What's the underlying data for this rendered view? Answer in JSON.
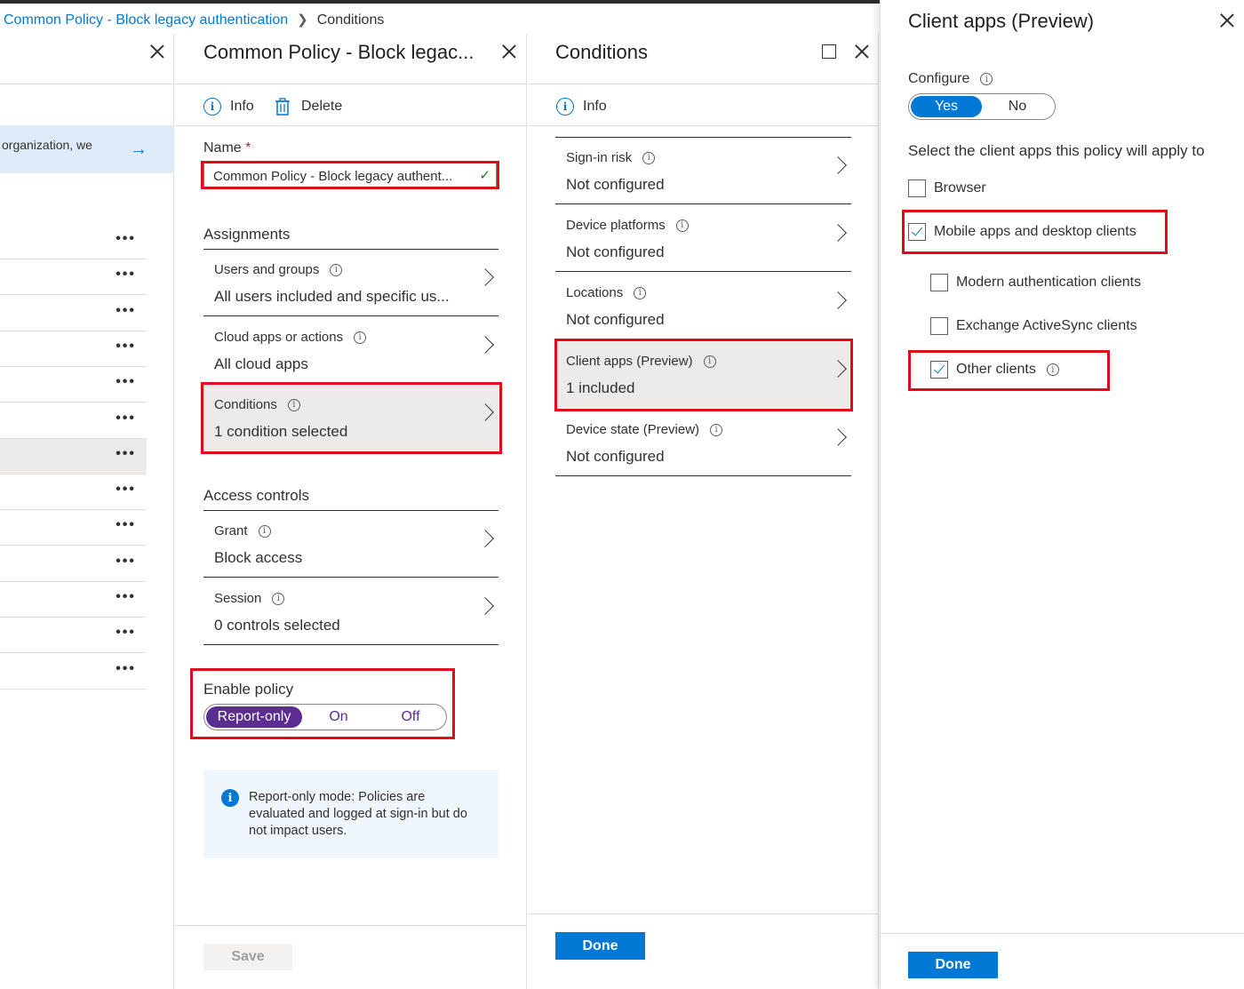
{
  "breadcrumb": {
    "link": "Common Policy - Block legacy authentication",
    "current": "Conditions"
  },
  "left_blade": {
    "banner_text": "organization, we",
    "row_count": 13
  },
  "policy_blade": {
    "title": "Common Policy - Block legac...",
    "toolbar": {
      "info": "Info",
      "delete": "Delete"
    },
    "name_label": "Name",
    "name_required": "*",
    "name_value": "Common Policy - Block legacy authent...",
    "assignments_title": "Assignments",
    "assignments": [
      {
        "title": "Users and groups",
        "value": "All users included and specific us..."
      },
      {
        "title": "Cloud apps or actions",
        "value": "All cloud apps"
      },
      {
        "title": "Conditions",
        "value": "1 condition selected"
      }
    ],
    "access_title": "Access controls",
    "access": [
      {
        "title": "Grant",
        "value": "Block access"
      },
      {
        "title": "Session",
        "value": "0 controls selected"
      }
    ],
    "enable_label": "Enable policy",
    "enable_options": [
      "Report-only",
      "On",
      "Off"
    ],
    "info_text": "Report-only mode: Policies are evaluated and logged at sign-in but do not impact users.",
    "save_label": "Save"
  },
  "conditions_blade": {
    "title": "Conditions",
    "toolbar": {
      "info": "Info"
    },
    "rows": [
      {
        "title": "Sign-in risk",
        "value": "Not configured"
      },
      {
        "title": "Device platforms",
        "value": "Not configured"
      },
      {
        "title": "Locations",
        "value": "Not configured"
      },
      {
        "title": "Client apps (Preview)",
        "value": "1 included"
      },
      {
        "title": "Device state (Preview)",
        "value": "Not configured"
      }
    ],
    "done_label": "Done"
  },
  "client_blade": {
    "title": "Client apps (Preview)",
    "configure_label": "Configure",
    "configure_options": [
      "Yes",
      "No"
    ],
    "select_text": "Select the client apps this policy will apply to",
    "options": {
      "browser": "Browser",
      "mobile": "Mobile apps and desktop clients",
      "modern": "Modern authentication clients",
      "activesync": "Exchange ActiveSync clients",
      "other": "Other clients"
    },
    "done_label": "Done"
  },
  "colors": {
    "accent": "#0078d4",
    "highlight_red": "#e00b1c",
    "report_only_purple": "#5c2d91"
  }
}
